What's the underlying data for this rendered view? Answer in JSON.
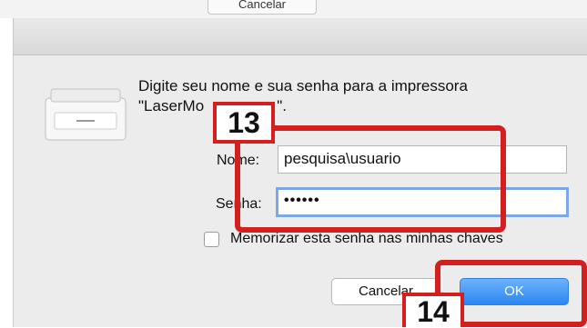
{
  "background": {
    "button_label": "Cancelar"
  },
  "dialog": {
    "message_line1": "Digite seu nome e sua senha para a impressora",
    "message_line2": "\"LaserMo",
    "message_line2_end": "\".",
    "name_label": "Nome:",
    "name_value": "pesquisa\\usuario",
    "password_label": "Senha:",
    "password_value": "••••••",
    "remember_label": "Memorizar esta senha nas minhas chaves",
    "cancel_label": "Cancelar",
    "ok_label": "OK"
  },
  "annotations": {
    "step_13": "13",
    "step_14": "14"
  },
  "colors": {
    "highlight": "#d3201f",
    "accent": "#2b86f2"
  }
}
